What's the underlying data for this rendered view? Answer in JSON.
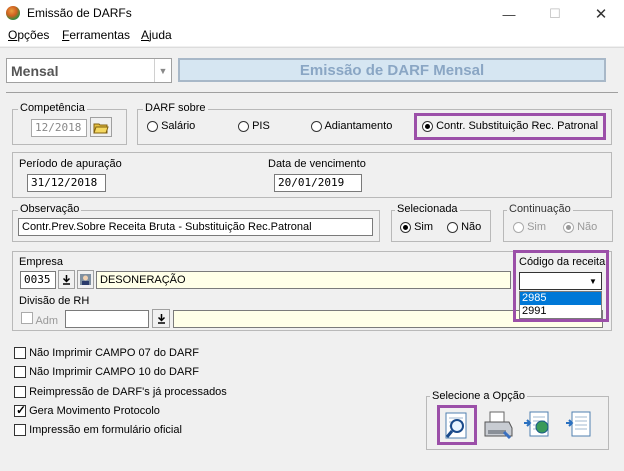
{
  "window": {
    "title": "Emissão de DARFs",
    "min": "—",
    "max": "☐",
    "close": "✕"
  },
  "menu": {
    "items": [
      "Opções",
      "Ferramentas",
      "Ajuda"
    ]
  },
  "header": {
    "mode_value": "Mensal",
    "banner": "Emissão de DARF Mensal"
  },
  "competencia": {
    "label": "Competência",
    "value": "12/2018"
  },
  "darf_sobre": {
    "label": "DARF sobre",
    "options": [
      "Salário",
      "PIS",
      "Adiantamento",
      "Contr. Substituição Rec. Patronal"
    ],
    "selected": "Contr. Substituição Rec. Patronal"
  },
  "periodo": {
    "label": "Período de apuração",
    "value": "31/12/2018"
  },
  "vencimento": {
    "label": "Data de vencimento",
    "value": "20/01/2019"
  },
  "observacao": {
    "label": "Observação",
    "value": "Contr.Prev.Sobre Receita Bruta - Substituição Rec.Patronal"
  },
  "selecionada": {
    "label": "Selecionada",
    "yes": "Sim",
    "no": "Não",
    "selected": "Sim"
  },
  "continuacao": {
    "label": "Continuação",
    "yes": "Sim",
    "no": "Não",
    "selected": "Não"
  },
  "empresa": {
    "label": "Empresa",
    "code": "0035",
    "name": "DESONERAÇÃO"
  },
  "codigo_receita": {
    "label": "Código da receita",
    "value": "",
    "options": [
      "2985",
      "2991"
    ],
    "highlighted": "2985"
  },
  "divisao": {
    "label": "Divisão de RH",
    "adm_label": "Adm"
  },
  "checkboxes": [
    {
      "label": "Não Imprimir CAMPO 07 do DARF",
      "checked": false
    },
    {
      "label": "Não Imprimir CAMPO 10 do DARF",
      "checked": false
    },
    {
      "label": "Reimpressão de DARF's já processados",
      "checked": false
    },
    {
      "label": "Gera Movimento Protocolo",
      "checked": true
    },
    {
      "label": "Impressão em formulário oficial",
      "checked": false
    }
  ],
  "selecione": {
    "label": "Selecione a Opção",
    "buttons": [
      "preview-icon",
      "printer-icon",
      "export-globe-icon",
      "export-document-icon"
    ]
  },
  "colors": {
    "highlight": "#9b4fa8",
    "selection": "#0078d7",
    "banner_bg": "#d6e6f2",
    "banner_text": "#8aa6c4"
  }
}
